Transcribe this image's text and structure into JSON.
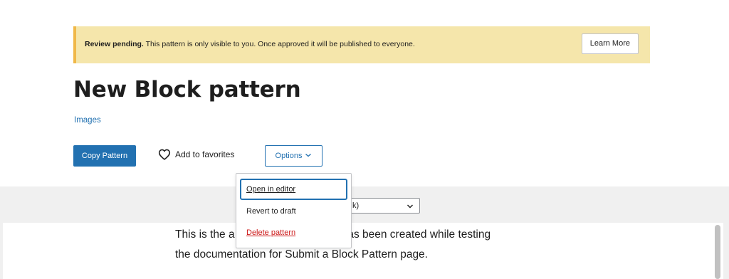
{
  "notice": {
    "bold": "Review pending.",
    "text": " This pattern is only visible to you. Once approved it will be published to everyone.",
    "button_label": "Learn More",
    "background": "#f5e6ab",
    "border_color": "#f0b849"
  },
  "pattern": {
    "title": "New Block pattern",
    "category": "Images"
  },
  "actions": {
    "copy_label": "Copy Pattern",
    "favorite_label": "Add to favorites",
    "favorite_icon": "heart-outline-icon",
    "options_label": "Options",
    "options_icon": "chevron-down-icon",
    "accent": "#2271b1"
  },
  "options_menu": {
    "items": [
      {
        "label": "Open in editor",
        "state": "focused"
      },
      {
        "label": "Revert to draft",
        "state": "normal"
      },
      {
        "label": "Delete pattern",
        "state": "danger"
      }
    ],
    "danger_color": "#cc1818"
  },
  "preview": {
    "width_select_value": "k)",
    "line1_start": "This is the a",
    "line1_end": "that has been created while testing",
    "line2": "the documentation for Submit a Block Pattern page."
  }
}
